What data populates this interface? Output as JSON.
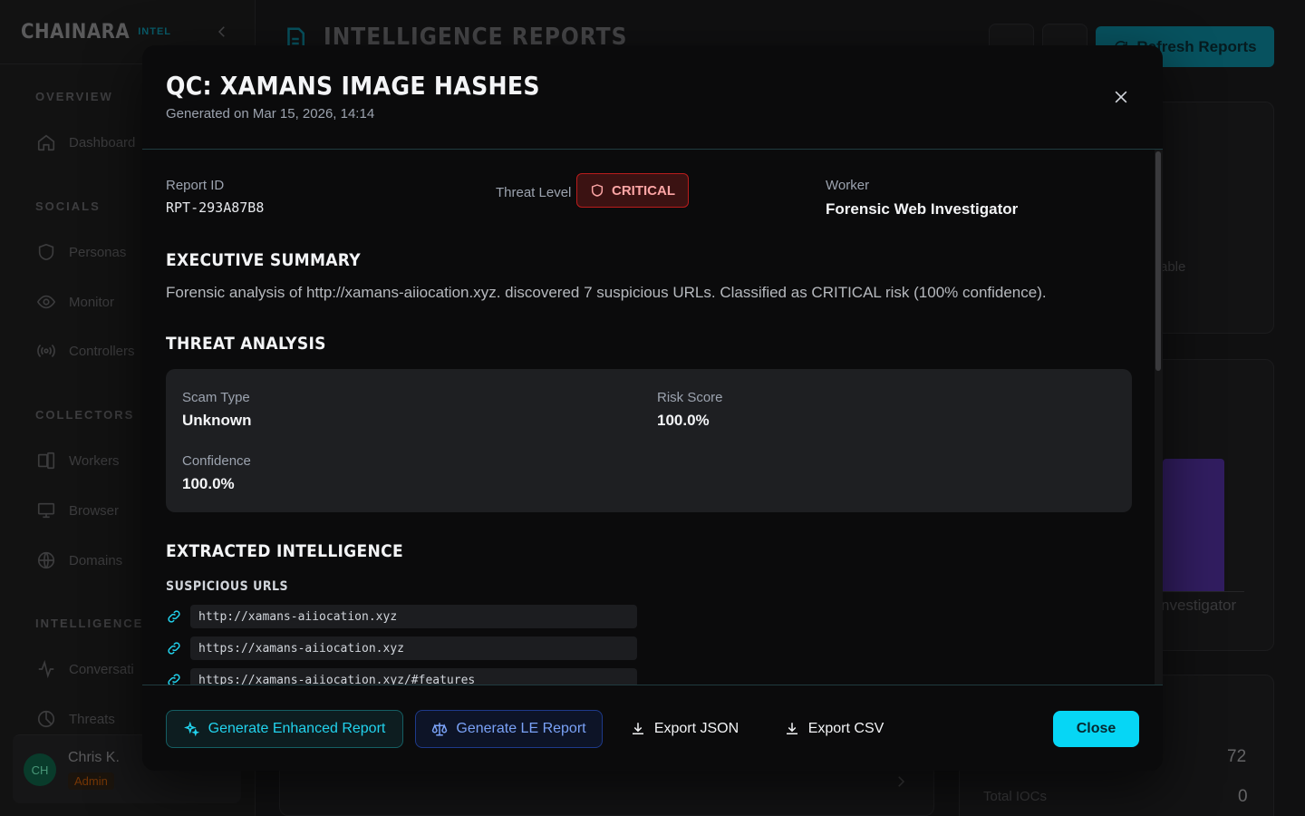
{
  "app": {
    "brand": "CHAINARA",
    "brand_tag": "INTEL",
    "page_title": "INTELLIGENCE REPORTS",
    "refresh_label": "Refresh Reports"
  },
  "sidebar": {
    "sections": {
      "overview": "OVERVIEW",
      "socials": "SOCIALS",
      "collectors": "COLLECTORS",
      "intelligence": "INTELLIGENCE"
    },
    "items": {
      "dashboard": "Dashboard",
      "personas": "Personas",
      "monitor": "Monitor",
      "controllers": "Controllers",
      "workers": "Workers",
      "browser": "Browser",
      "domains": "Domains",
      "conversations": "Conversati",
      "threats": "Threats"
    },
    "user": {
      "initials": "CH",
      "name": "Chris K.",
      "role": "Admin"
    }
  },
  "background": {
    "frag_able": "able",
    "frag_investigator": "nvestigator",
    "stat_value": "72",
    "total_iocs_label": "Total IOCs",
    "total_iocs_value": "0"
  },
  "modal": {
    "title": "QC: XAMANS IMAGE HASHES",
    "subtitle": "Generated on Mar 15, 2026, 14:14",
    "report_id_label": "Report ID",
    "report_id": "RPT-293A87B8",
    "threat_level_label": "Threat Level",
    "threat_level": "CRITICAL",
    "worker_label": "Worker",
    "worker": "Forensic Web Investigator",
    "exec_summary_heading": "EXECUTIVE SUMMARY",
    "exec_summary": "Forensic analysis of http://xamans-aiiocation.xyz. discovered 7 suspicious URLs. Classified as CRITICAL risk (100% confidence).",
    "threat_analysis_heading": "THREAT ANALYSIS",
    "analysis": {
      "scam_type_label": "Scam Type",
      "scam_type": "Unknown",
      "risk_score_label": "Risk Score",
      "risk_score": "100.0%",
      "confidence_label": "Confidence",
      "confidence": "100.0%"
    },
    "extracted_heading": "EXTRACTED INTELLIGENCE",
    "suspicious_urls_heading": "SUSPICIOUS URLS",
    "urls": [
      "http://xamans-aiiocation.xyz",
      "https://xamans-aiiocation.xyz",
      "https://xamans-aiiocation.xyz/#features"
    ],
    "buttons": {
      "enhanced": "Generate Enhanced Report",
      "le": "Generate LE Report",
      "export_json": "Export JSON",
      "export_csv": "Export CSV",
      "close": "Close"
    }
  },
  "colors": {
    "accent_cyan": "#06d6f5",
    "critical_red": "#b91c1c",
    "chart_purple": "#4c2d94"
  }
}
